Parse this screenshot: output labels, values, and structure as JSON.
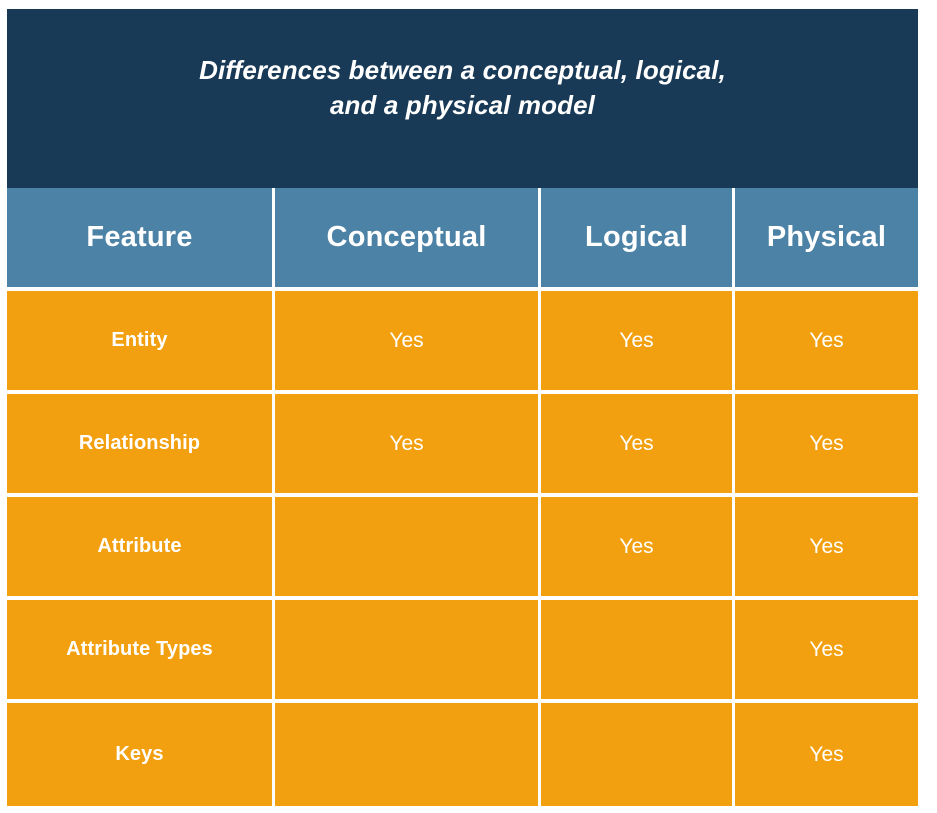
{
  "slide": {
    "title": "Differences between a conceptual, logical,\nand a physical model",
    "colors": {
      "banner_background": "#193A56",
      "header_background": "#4C82A5",
      "row_background": "#F2A00F",
      "text": "#FFFFFF",
      "divider": "#FFFFFF",
      "page_background": "#FFFFFF"
    }
  },
  "table": {
    "columns": [
      {
        "key": "feature",
        "label": "Feature"
      },
      {
        "key": "conceptual",
        "label": "Conceptual"
      },
      {
        "key": "logical",
        "label": "Logical"
      },
      {
        "key": "physical",
        "label": "Physical"
      }
    ],
    "rows": [
      {
        "feature": "Entity",
        "conceptual": "Yes",
        "logical": "Yes",
        "physical": "Yes"
      },
      {
        "feature": "Relationship",
        "conceptual": "Yes",
        "logical": "Yes",
        "physical": "Yes"
      },
      {
        "feature": "Attribute",
        "conceptual": "",
        "logical": "Yes",
        "physical": "Yes"
      },
      {
        "feature": "Attribute Types",
        "conceptual": "",
        "logical": "",
        "physical": "Yes"
      },
      {
        "feature": "Keys",
        "conceptual": "",
        "logical": "",
        "physical": "Yes"
      }
    ]
  }
}
